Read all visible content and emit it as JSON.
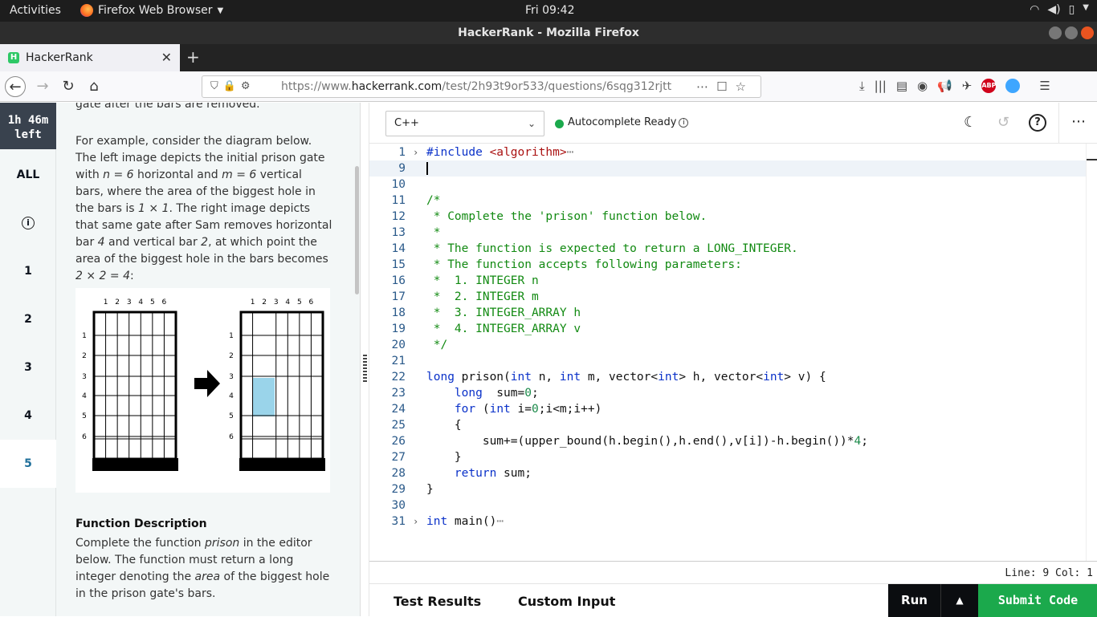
{
  "topbar": {
    "activities": "Activities",
    "app": "Firefox Web Browser",
    "clock": "Fri 09:42"
  },
  "window": {
    "title": "HackerRank - Mozilla Firefox"
  },
  "browser": {
    "tab_title": "HackerRank",
    "tab_icon_letter": "H",
    "url_prefix": "https://www.",
    "url_domain": "hackerrank.com",
    "url_path": "/test/2h93t9or533/questions/6sqg312rjtt"
  },
  "sidenav": {
    "timer": "1h 46m left",
    "items": [
      {
        "label": "ALL"
      },
      {
        "label": "i"
      },
      {
        "label": "1"
      },
      {
        "label": "2"
      },
      {
        "label": "3"
      },
      {
        "label": "4"
      },
      {
        "label": "5"
      }
    ]
  },
  "problem": {
    "cut_line": "gate after the bars are removed.",
    "example_parts": [
      "For example, consider the diagram below. The left image depicts the initial prison gate with ",
      "n = 6",
      " horizontal and ",
      "m = 6",
      " vertical bars, where the area of the biggest hole in the bars is ",
      "1 × 1",
      ". The right image depicts that same gate after Sam removes horizontal bar ",
      "4",
      " and vertical bar ",
      "2",
      ", at which point the area of the biggest hole in the bars becomes ",
      "2 × 2 = 4",
      ":"
    ],
    "diagram_col_labels": [
      "1",
      "2",
      "3",
      "4",
      "5",
      "6"
    ],
    "diagram_row_labels": [
      "1",
      "2",
      "3",
      "4",
      "5",
      "6"
    ],
    "function_description_title": "Function Description",
    "fdesc_parts": [
      "Complete the function ",
      "prison",
      " in the editor below. The function must return a long integer denoting the ",
      "area",
      " of the biggest hole in the prison gate's bars."
    ]
  },
  "editor": {
    "language": "C++",
    "autocomplete": "Autocomplete Ready",
    "status": "Line: 9 Col: 1",
    "lines": [
      {
        "n": "1",
        "fold": "›",
        "html": "<span class=\"kw\">#include</span> <span class=\"str\">&lt;algorithm&gt;</span><span style=\"color:#888\">⋯</span>"
      },
      {
        "n": "9",
        "fold": "",
        "html": "",
        "current": true
      },
      {
        "n": "10",
        "fold": "",
        "html": ""
      },
      {
        "n": "11",
        "fold": "",
        "html": "<span class=\"cm\">/*</span>"
      },
      {
        "n": "12",
        "fold": "",
        "html": "<span class=\"cm\"> * Complete the 'prison' function below.</span>"
      },
      {
        "n": "13",
        "fold": "",
        "html": "<span class=\"cm\"> *</span>"
      },
      {
        "n": "14",
        "fold": "",
        "html": "<span class=\"cm\"> * The function is expected to return a LONG_INTEGER.</span>"
      },
      {
        "n": "15",
        "fold": "",
        "html": "<span class=\"cm\"> * The function accepts following parameters:</span>"
      },
      {
        "n": "16",
        "fold": "",
        "html": "<span class=\"cm\"> *  1. INTEGER n</span>"
      },
      {
        "n": "17",
        "fold": "",
        "html": "<span class=\"cm\"> *  2. INTEGER m</span>"
      },
      {
        "n": "18",
        "fold": "",
        "html": "<span class=\"cm\"> *  3. INTEGER_ARRAY h</span>"
      },
      {
        "n": "19",
        "fold": "",
        "html": "<span class=\"cm\"> *  4. INTEGER_ARRAY v</span>"
      },
      {
        "n": "20",
        "fold": "",
        "html": "<span class=\"cm\"> */</span>"
      },
      {
        "n": "21",
        "fold": "",
        "html": ""
      },
      {
        "n": "22",
        "fold": "",
        "html": "<span class=\"kw\">long</span> prison(<span class=\"kw\">int</span> n, <span class=\"kw\">int</span> m, vector&lt;<span class=\"kw\">int</span>&gt; h, vector&lt;<span class=\"kw\">int</span>&gt; v) {"
      },
      {
        "n": "23",
        "fold": "",
        "html": "    <span class=\"kw\">long</span>  sum=<span class=\"num\">0</span>;"
      },
      {
        "n": "24",
        "fold": "",
        "html": "    <span class=\"kw\">for</span> (<span class=\"kw\">int</span> i=<span class=\"num\">0</span>;i&lt;m;i++)"
      },
      {
        "n": "25",
        "fold": "",
        "html": "    {"
      },
      {
        "n": "26",
        "fold": "",
        "html": "        sum+=(upper_bound(h.begin(),h.end(),v[i])-h.begin())*<span class=\"num\">4</span>;"
      },
      {
        "n": "27",
        "fold": "",
        "html": "    }"
      },
      {
        "n": "28",
        "fold": "",
        "html": "    <span class=\"kw\">return</span> sum;"
      },
      {
        "n": "29",
        "fold": "",
        "html": "}"
      },
      {
        "n": "30",
        "fold": "",
        "html": ""
      },
      {
        "n": "31",
        "fold": "›",
        "html": "<span class=\"kw\">int</span> main()<span style=\"color:#888\">⋯</span>"
      }
    ]
  },
  "bottom": {
    "test_results": "Test Results",
    "custom_input": "Custom Input",
    "run": "Run",
    "submit": "Submit Code"
  }
}
